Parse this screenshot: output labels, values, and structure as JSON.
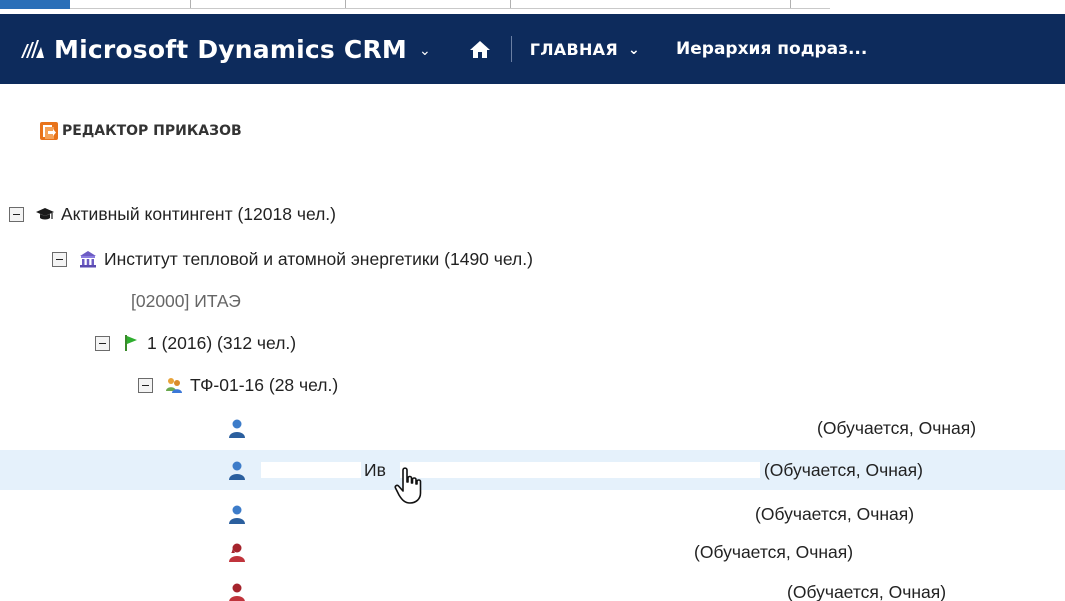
{
  "nav": {
    "app_title": "Microsoft Dynamics CRM",
    "main_menu_label": "ГЛАВНАЯ",
    "breadcrumb": "Иерархия подраз..."
  },
  "toolbar": {
    "editor_label": "РЕДАКТОР ПРИКАЗОВ"
  },
  "tree": {
    "root": {
      "label": "Активный контингент (12018 чел.)"
    },
    "institute": {
      "label": "Институт тепловой и атомной энергетики (1490 чел.)",
      "code": "[02000] ИТАЭ"
    },
    "course": {
      "label": "1 (2016) (312 чел.)"
    },
    "group": {
      "label": "ТФ-01-16 (28 чел.)"
    },
    "students": [
      {
        "status": "(Обучается, Очная)",
        "gender": "male"
      },
      {
        "name_fragment": "Ив",
        "status": "(Обучается, Очная)",
        "gender": "male",
        "selected": true
      },
      {
        "status": "(Обучается, Очная)",
        "gender": "male"
      },
      {
        "status": "(Обучается, Очная)",
        "gender": "female"
      },
      {
        "status": "(Обучается, Очная)",
        "gender": "female"
      }
    ]
  },
  "colors": {
    "navbar": "#0d2b5c",
    "selection": "#e5f1fb",
    "accent_orange": "#e8731a"
  }
}
